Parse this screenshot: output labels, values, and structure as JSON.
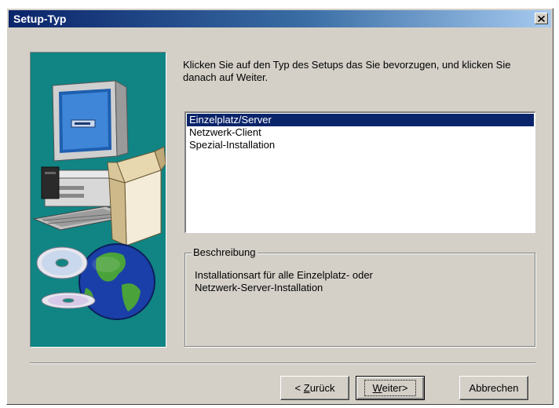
{
  "window": {
    "title": "Setup-Typ",
    "close_glyph": "✕"
  },
  "instructions": "Klicken Sie auf den Typ des Setups das Sie bevorzugen, und klicken Sie danach auf Weiter.",
  "setup_types": {
    "items": [
      "Einzelplatz/Server",
      "Netzwerk-Client",
      "Spezial-Installation"
    ],
    "selected_index": 0
  },
  "description": {
    "label": "Beschreibung",
    "text_line1": "Installationsart für alle Einzelplatz- oder",
    "text_line2": "Netzwerk-Server-Installation"
  },
  "buttons": {
    "back_prefix": "< ",
    "back_hotkey": "Z",
    "back_rest": "urück",
    "next_hotkey": "W",
    "next_rest": "eiter>",
    "cancel": "Abbrechen"
  },
  "icons": {
    "art": [
      "computer-icon",
      "box-icon",
      "cd-icon",
      "globe-icon"
    ],
    "close": "close-icon"
  },
  "colors": {
    "title_gradient_start": "#0a246a",
    "title_gradient_end": "#a6caf0",
    "art_background": "#118484",
    "selection": "#0a246a",
    "dialog_face": "#d4d0c8"
  }
}
